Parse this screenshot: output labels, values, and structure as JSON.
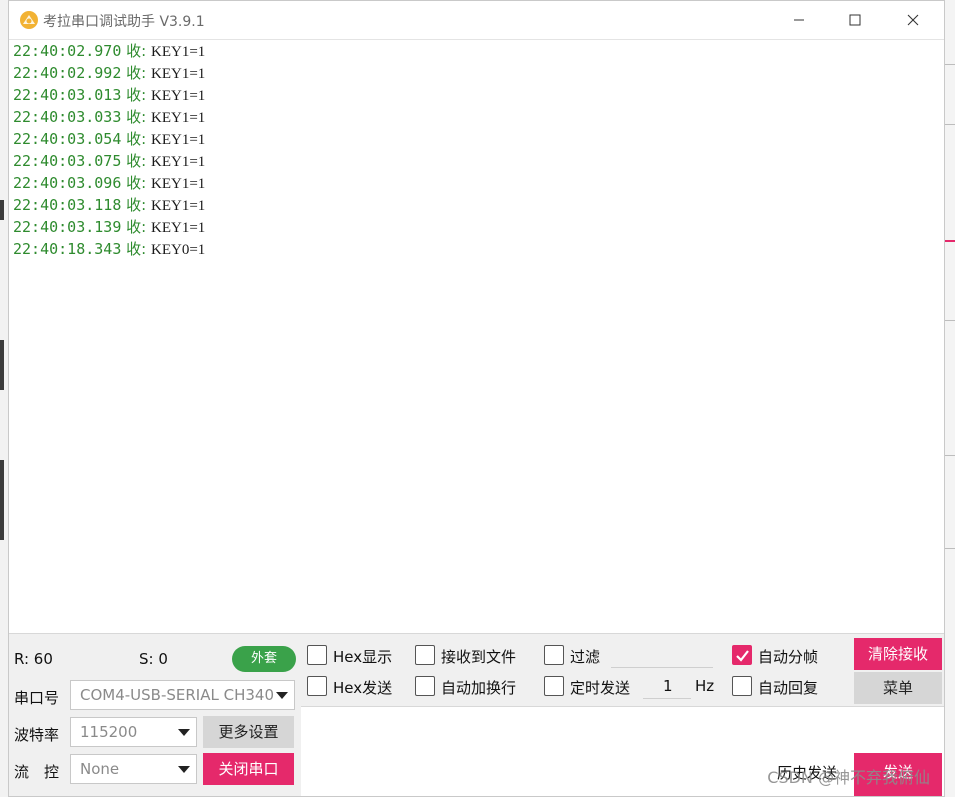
{
  "window": {
    "title": "考拉串口调试助手 V3.9.1"
  },
  "log": [
    {
      "time": "22:40:02.970",
      "dir": "收:",
      "data": "KEY1=1"
    },
    {
      "time": "22:40:02.992",
      "dir": "收:",
      "data": "KEY1=1"
    },
    {
      "time": "22:40:03.013",
      "dir": "收:",
      "data": "KEY1=1"
    },
    {
      "time": "22:40:03.033",
      "dir": "收:",
      "data": "KEY1=1"
    },
    {
      "time": "22:40:03.054",
      "dir": "收:",
      "data": "KEY1=1"
    },
    {
      "time": "22:40:03.075",
      "dir": "收:",
      "data": "KEY1=1"
    },
    {
      "time": "22:40:03.096",
      "dir": "收:",
      "data": "KEY1=1"
    },
    {
      "time": "22:40:03.118",
      "dir": "收:",
      "data": "KEY1=1"
    },
    {
      "time": "22:40:03.139",
      "dir": "收:",
      "data": "KEY1=1"
    },
    {
      "time": "22:40:18.343",
      "dir": "收:",
      "data": "KEY0=1"
    }
  ],
  "status": {
    "received": "R: 60",
    "sent": "S: 0",
    "external_button": "外套"
  },
  "port": {
    "port_label": "串口号",
    "port_value": "COM4-USB-SERIAL CH340",
    "baud_label": "波特率",
    "baud_value": "115200",
    "more_settings": "更多设置",
    "flow_label": "流　控",
    "flow_value": "None",
    "close_port": "关闭串口"
  },
  "options": {
    "hex_display": "Hex显示",
    "hex_display_checked": false,
    "receive_to_file": "接收到文件",
    "receive_to_file_checked": false,
    "filter": "过滤",
    "filter_checked": false,
    "filter_value": "",
    "auto_frame": "自动分帧",
    "auto_frame_checked": true,
    "clear_receive": "清除接收",
    "hex_send": "Hex发送",
    "hex_send_checked": false,
    "auto_newline": "自动加换行",
    "auto_newline_checked": false,
    "timed_send": "定时发送",
    "timed_send_checked": false,
    "timed_value": "1",
    "timed_unit": "Hz",
    "auto_reply": "自动回复",
    "auto_reply_checked": false,
    "menu": "菜单"
  },
  "send": {
    "history": "历史发送",
    "send_button": "发送",
    "input_value": ""
  },
  "watermark": "CSDN @神不弃我俯仙",
  "colors": {
    "accent": "#e5296b",
    "green": "#3aa24a",
    "log_green": "#2e8b2e"
  }
}
